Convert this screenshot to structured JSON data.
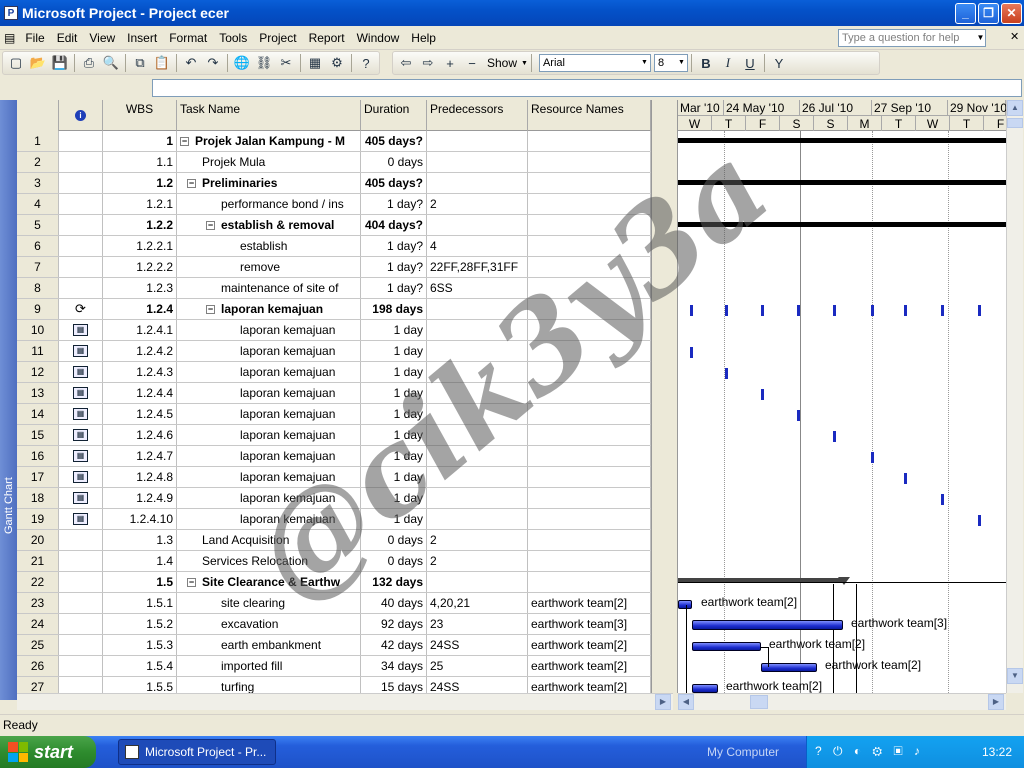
{
  "window": {
    "title": "Microsoft Project - Project ecer"
  },
  "menu": [
    "File",
    "Edit",
    "View",
    "Insert",
    "Format",
    "Tools",
    "Project",
    "Report",
    "Window",
    "Help"
  ],
  "help_placeholder": "Type a question for help",
  "toolbar": {
    "show_label": "Show",
    "font": "Arial",
    "size": "8"
  },
  "view_bar_label": "Gantt Chart",
  "columns": {
    "wbs": "WBS",
    "task_name": "Task Name",
    "duration": "Duration",
    "predecessors": "Predecessors",
    "resources": "Resource Names"
  },
  "rows": [
    {
      "id": "1",
      "wbs": "1",
      "name": "Projek Jalan Kampung - M",
      "dur": "405 days?",
      "pred": "",
      "res": "",
      "bold": true,
      "level": 0,
      "toggle": "−"
    },
    {
      "id": "2",
      "wbs": "1.1",
      "name": "Projek Mula",
      "dur": "0 days",
      "pred": "",
      "res": "",
      "bold": false,
      "level": 1
    },
    {
      "id": "3",
      "wbs": "1.2",
      "name": "Preliminaries",
      "dur": "405 days?",
      "pred": "",
      "res": "",
      "bold": true,
      "level": 1,
      "toggle": "−"
    },
    {
      "id": "4",
      "wbs": "1.2.1",
      "name": "performance bond / ins",
      "dur": "1 day?",
      "pred": "2",
      "res": "",
      "bold": false,
      "level": 2
    },
    {
      "id": "5",
      "wbs": "1.2.2",
      "name": "establish & removal",
      "dur": "404 days?",
      "pred": "",
      "res": "",
      "bold": true,
      "level": 2,
      "toggle": "−"
    },
    {
      "id": "6",
      "wbs": "1.2.2.1",
      "name": "establish",
      "dur": "1 day?",
      "pred": "4",
      "res": "",
      "bold": false,
      "level": 3
    },
    {
      "id": "7",
      "wbs": "1.2.2.2",
      "name": "remove",
      "dur": "1 day?",
      "pred": "22FF,28FF,31FF",
      "res": "",
      "bold": false,
      "level": 3
    },
    {
      "id": "8",
      "wbs": "1.2.3",
      "name": "maintenance of site of",
      "dur": "1 day?",
      "pred": "6SS",
      "res": "",
      "bold": false,
      "level": 2
    },
    {
      "id": "9",
      "wbs": "1.2.4",
      "name": "laporan kemajuan",
      "dur": "198 days",
      "pred": "",
      "res": "",
      "bold": true,
      "level": 2,
      "toggle": "−",
      "ind": "recurring-icon"
    },
    {
      "id": "10",
      "wbs": "1.2.4.1",
      "name": "laporan kemajuan",
      "dur": "1 day",
      "pred": "",
      "res": "",
      "bold": false,
      "level": 3,
      "ind": "calendar-icon"
    },
    {
      "id": "11",
      "wbs": "1.2.4.2",
      "name": "laporan kemajuan",
      "dur": "1 day",
      "pred": "",
      "res": "",
      "bold": false,
      "level": 3,
      "ind": "calendar-icon"
    },
    {
      "id": "12",
      "wbs": "1.2.4.3",
      "name": "laporan kemajuan",
      "dur": "1 day",
      "pred": "",
      "res": "",
      "bold": false,
      "level": 3,
      "ind": "calendar-icon"
    },
    {
      "id": "13",
      "wbs": "1.2.4.4",
      "name": "laporan kemajuan",
      "dur": "1 day",
      "pred": "",
      "res": "",
      "bold": false,
      "level": 3,
      "ind": "calendar-icon"
    },
    {
      "id": "14",
      "wbs": "1.2.4.5",
      "name": "laporan kemajuan",
      "dur": "1 day",
      "pred": "",
      "res": "",
      "bold": false,
      "level": 3,
      "ind": "calendar-icon"
    },
    {
      "id": "15",
      "wbs": "1.2.4.6",
      "name": "laporan kemajuan",
      "dur": "1 day",
      "pred": "",
      "res": "",
      "bold": false,
      "level": 3,
      "ind": "calendar-icon"
    },
    {
      "id": "16",
      "wbs": "1.2.4.7",
      "name": "laporan kemajuan",
      "dur": "1 day",
      "pred": "",
      "res": "",
      "bold": false,
      "level": 3,
      "ind": "calendar-icon"
    },
    {
      "id": "17",
      "wbs": "1.2.4.8",
      "name": "laporan kemajuan",
      "dur": "1 day",
      "pred": "",
      "res": "",
      "bold": false,
      "level": 3,
      "ind": "calendar-icon"
    },
    {
      "id": "18",
      "wbs": "1.2.4.9",
      "name": "laporan kemajuan",
      "dur": "1 day",
      "pred": "",
      "res": "",
      "bold": false,
      "level": 3,
      "ind": "calendar-icon"
    },
    {
      "id": "19",
      "wbs": "1.2.4.10",
      "name": "laporan kemajuan",
      "dur": "1 day",
      "pred": "",
      "res": "",
      "bold": false,
      "level": 3,
      "ind": "calendar-icon"
    },
    {
      "id": "20",
      "wbs": "1.3",
      "name": "Land Acquisition",
      "dur": "0 days",
      "pred": "2",
      "res": "",
      "bold": false,
      "level": 1
    },
    {
      "id": "21",
      "wbs": "1.4",
      "name": "Services Relocation",
      "dur": "0 days",
      "pred": "2",
      "res": "",
      "bold": false,
      "level": 1
    },
    {
      "id": "22",
      "wbs": "1.5",
      "name": "Site Clearance & Earthw",
      "dur": "132 days",
      "pred": "",
      "res": "",
      "bold": true,
      "level": 1,
      "toggle": "−"
    },
    {
      "id": "23",
      "wbs": "1.5.1",
      "name": "site clearing",
      "dur": "40 days",
      "pred": "4,20,21",
      "res": "earthwork team[2]",
      "bold": false,
      "level": 2
    },
    {
      "id": "24",
      "wbs": "1.5.2",
      "name": "excavation",
      "dur": "92 days",
      "pred": "23",
      "res": "earthwork team[3]",
      "bold": false,
      "level": 2
    },
    {
      "id": "25",
      "wbs": "1.5.3",
      "name": "earth embankment",
      "dur": "42 days",
      "pred": "24SS",
      "res": "earthwork team[2]",
      "bold": false,
      "level": 2
    },
    {
      "id": "26",
      "wbs": "1.5.4",
      "name": "imported fill",
      "dur": "34 days",
      "pred": "25",
      "res": "earthwork team[2]",
      "bold": false,
      "level": 2
    },
    {
      "id": "27",
      "wbs": "1.5.5",
      "name": "turfing",
      "dur": "15 days",
      "pred": "24SS",
      "res": "earthwork team[2]",
      "bold": false,
      "level": 2
    }
  ],
  "timescale": {
    "top": [
      "Mar '10",
      "24 May '10",
      "26 Jul '10",
      "27 Sep '10",
      "29 Nov '10"
    ],
    "bottom": [
      "W",
      "T",
      "F",
      "S",
      "S",
      "M",
      "T",
      "W",
      "T",
      "F"
    ]
  },
  "gantt_labels": {
    "r23": "earthwork team[2]",
    "r24": "earthwork team[3]",
    "r25": "earthwork team[2]",
    "r26": "earthwork team[2]",
    "r27": "earthwork team[2]"
  },
  "watermark": "@cik3y3a",
  "status": "Ready",
  "taskbar": {
    "start": "start",
    "task": "Microsoft Project - Pr...",
    "my_computer": "My Computer",
    "clock": "13:22"
  }
}
